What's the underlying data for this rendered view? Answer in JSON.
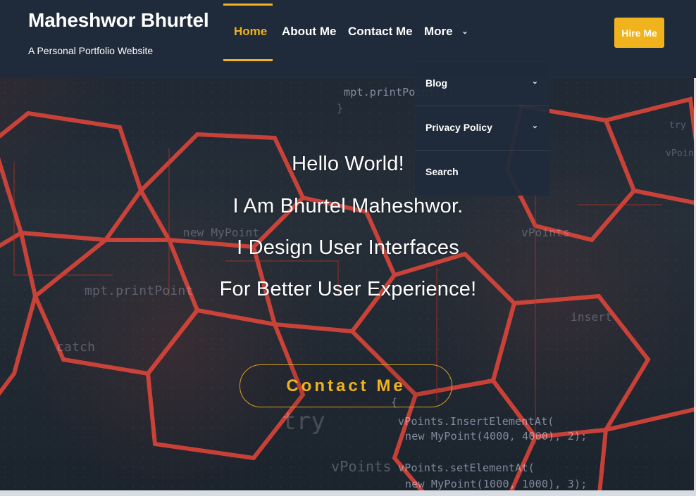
{
  "brand": {
    "title": "Maheshwor Bhurtel",
    "subtitle": "A Personal Portfolio Website"
  },
  "nav": {
    "items": [
      {
        "label": "Home",
        "active": true
      },
      {
        "label": "About Me",
        "active": false
      },
      {
        "label": "Contact Me",
        "active": false
      },
      {
        "label": "More",
        "active": false
      }
    ],
    "hire_label": "Hire Me"
  },
  "dropdown": {
    "items": [
      {
        "label": "Blog",
        "has_caret": true
      },
      {
        "label": "Privacy Policy",
        "has_caret": true
      },
      {
        "label": "Search",
        "has_caret": false
      }
    ]
  },
  "hero": {
    "lines": [
      "Hello World!",
      "I Am Bhurtel Maheshwor.",
      "I Design User Interfaces",
      "For Better User Experience!"
    ],
    "button_label": "Contact Me"
  },
  "background_code": {
    "lines": [
      "mpt.printPoint();",
      "}",
      "try",
      "{",
      "vPoints.InsertElementAt(",
      "new MyPoint(4000, 4000), 2);",
      "vPoints.setElementAt(",
      "new MyPoint(1000, 1000), 3);",
      "try",
      "vPoints.insertElementAt",
      "mpt.printPoint",
      "catch",
      "new MyPoint",
      "vPoints",
      "insert",
      "vPoints"
    ]
  },
  "icons": {
    "nav_more_caret": "chevron-down-icon",
    "dropdown_caret": "chevron-down-icon"
  },
  "colors": {
    "accent": "#f0b21d",
    "header_bg": "#1f2a3a"
  }
}
